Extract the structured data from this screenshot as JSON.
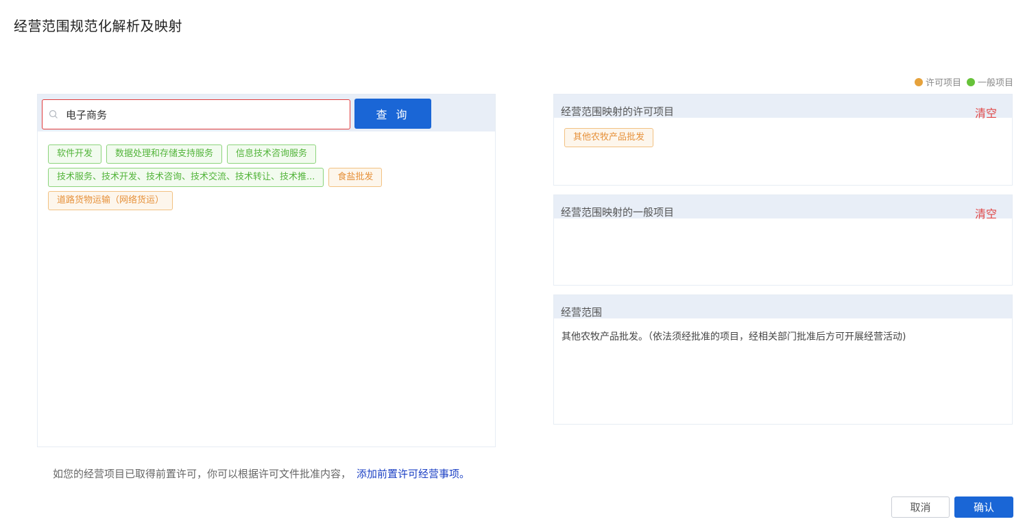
{
  "page": {
    "title": "经营范围规范化解析及映射"
  },
  "legend": {
    "items": [
      {
        "label": "许可项目",
        "color": "#e6a23c"
      },
      {
        "label": "一般项目",
        "color": "#67c23a"
      }
    ]
  },
  "search": {
    "value": "电子商务",
    "button_label": "查 询"
  },
  "results": {
    "tags": [
      {
        "label": "软件开发",
        "type": "general"
      },
      {
        "label": "数据处理和存储支持服务",
        "type": "general"
      },
      {
        "label": "信息技术咨询服务",
        "type": "general"
      },
      {
        "label": "技术服务、技术开发、技术咨询、技术交流、技术转让、技术推...",
        "type": "general"
      },
      {
        "label": "食盐批发",
        "type": "licensed"
      },
      {
        "label": "道路货物运输（网络货运）",
        "type": "licensed"
      }
    ]
  },
  "licensed_box": {
    "title": "经营范围映射的许可项目",
    "clear_label": "清空",
    "tags": [
      {
        "label": "其他农牧产品批发"
      }
    ]
  },
  "general_box": {
    "title": "经营范围映射的一般项目",
    "clear_label": "清空"
  },
  "scope_box": {
    "title": "经营范围",
    "text": "其他农牧产品批发。（依法须经批准的项目，经相关部门批准后方可开展经营活动)"
  },
  "hint": {
    "text": "如您的经营项目已取得前置许可，你可以根据许可文件批准内容，",
    "link": "添加前置许可经营事项。"
  },
  "footer": {
    "cancel_label": "取消",
    "confirm_label": "确认"
  }
}
